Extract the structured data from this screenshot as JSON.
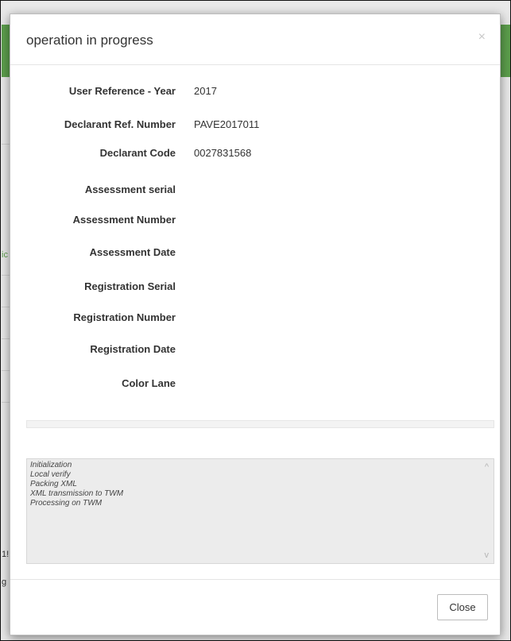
{
  "background": {
    "fragments": [
      "ic",
      "1!",
      "g"
    ]
  },
  "modal": {
    "title": "operation in progress",
    "close_icon": "×",
    "fields": [
      {
        "label": "User Reference - Year",
        "value": "2017"
      },
      {
        "label": "Declarant Ref. Number",
        "value": "PAVE2017011"
      },
      {
        "label": "Declarant Code",
        "value": "0027831568"
      },
      {
        "label": "Assessment serial",
        "value": ""
      },
      {
        "label": "Assessment Number",
        "value": ""
      },
      {
        "label": "Assessment Date",
        "value": ""
      },
      {
        "label": "Registration Serial",
        "value": ""
      },
      {
        "label": "Registration Number",
        "value": ""
      },
      {
        "label": "Registration Date",
        "value": ""
      },
      {
        "label": "Color Lane",
        "value": ""
      }
    ],
    "progress": 0,
    "log": [
      "Initialization",
      "Local verify",
      "Packing XML",
      "XML transmission to TWM",
      "Processing on TWM"
    ],
    "scroll_up_icon": "^",
    "scroll_down_icon": "v",
    "close_button_label": "Close"
  },
  "colors": {
    "accent_green": "#5c9e4c"
  }
}
